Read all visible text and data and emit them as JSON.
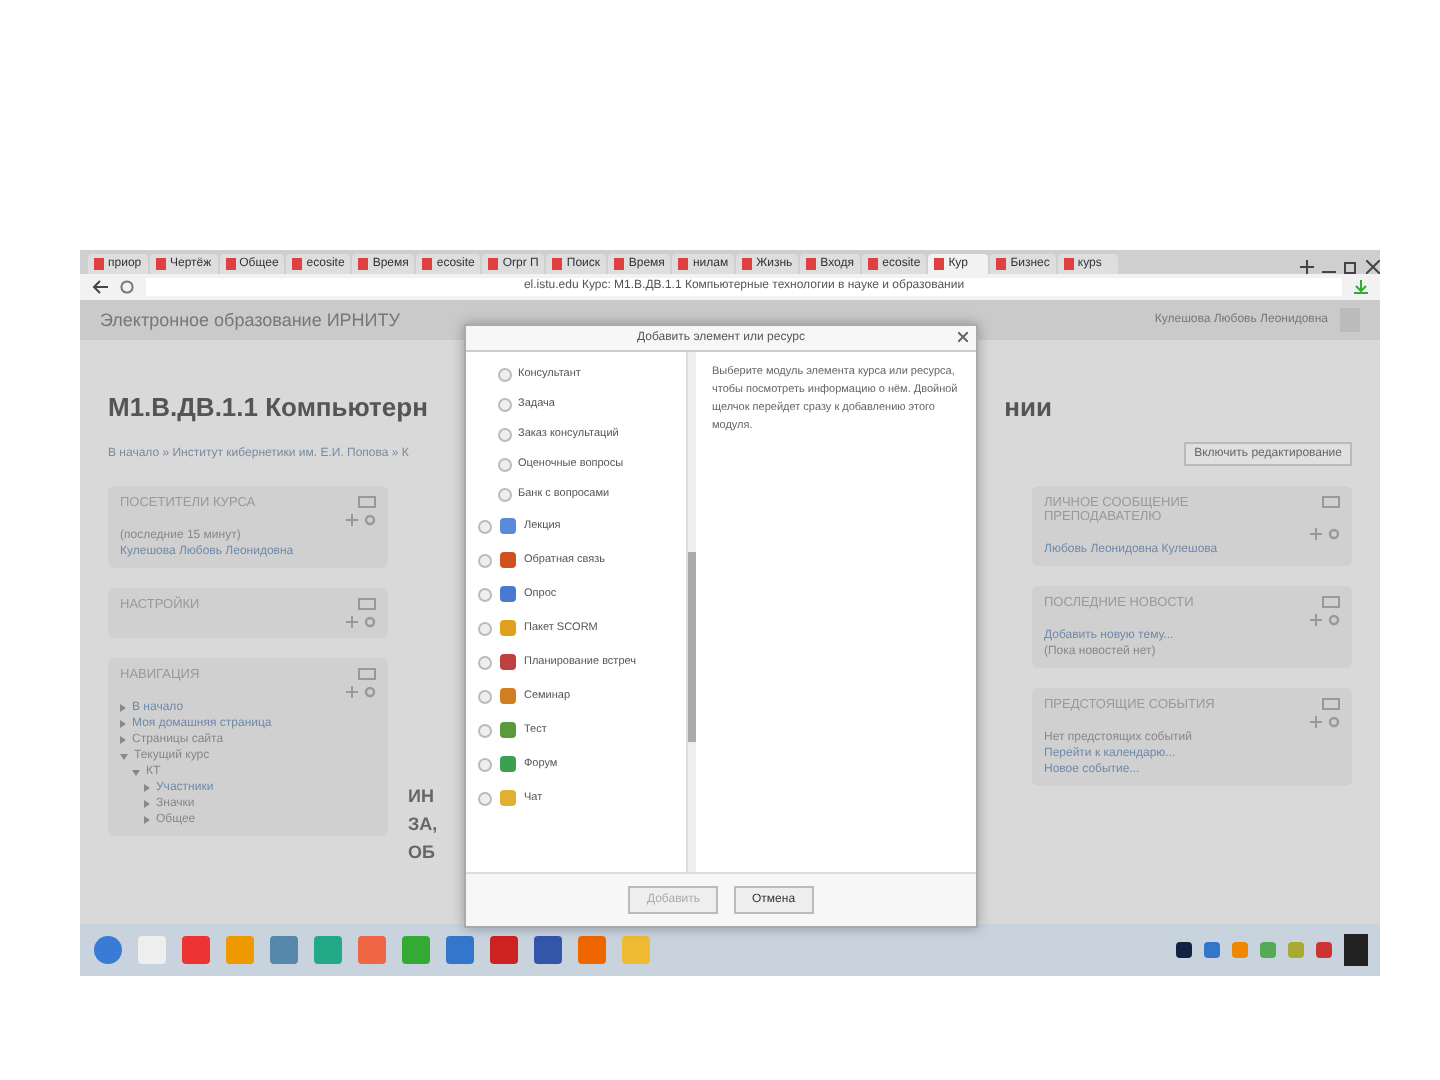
{
  "browser": {
    "tabs": [
      {
        "label": "приор",
        "selected": false
      },
      {
        "label": "Чертёж",
        "selected": false
      },
      {
        "label": "Общее",
        "selected": false
      },
      {
        "label": "ecosite",
        "selected": false
      },
      {
        "label": "Время",
        "selected": false
      },
      {
        "label": "ecosite",
        "selected": false
      },
      {
        "label": "Orpr П",
        "selected": false
      },
      {
        "label": "Поиск",
        "selected": false
      },
      {
        "label": "Время",
        "selected": false
      },
      {
        "label": "нилам",
        "selected": false
      },
      {
        "label": "Жизнь",
        "selected": false
      },
      {
        "label": "Входя",
        "selected": false
      },
      {
        "label": "ecosite",
        "selected": false
      },
      {
        "label": "Кур",
        "selected": true
      },
      {
        "label": "Бизнес",
        "selected": false
      },
      {
        "label": "курs",
        "selected": false
      }
    ],
    "address": "el.istu.edu Курс: М1.В.ДВ.1.1 Компьютерные технологии в науке и образовании"
  },
  "header": {
    "site_name": "Электронное образование ИРНИТУ",
    "user_name": "Кулешова Любовь Леонидовна"
  },
  "course": {
    "title_left": "М1.В.ДВ.1.1 Компьютерн",
    "title_right": "нии",
    "breadcrumb": "В начало » Институт кибернетики им. Е.И. Попова » К",
    "edit_button": "Включить редактирование",
    "section_fragments": [
      "ИН",
      "ЗА,",
      "ОБ"
    ]
  },
  "left_blocks": [
    {
      "title": "ПОСЕТИТЕЛИ КУРСА",
      "lines": [
        {
          "text": "(последние 15 минут)",
          "link": false
        },
        {
          "text": "Кулешова Любовь Леонидовна",
          "link": true
        }
      ]
    },
    {
      "title": "НАСТРОЙКИ"
    },
    {
      "title": "НАВИГАЦИЯ",
      "tree": [
        {
          "label": "В начало",
          "expanded": false,
          "link": true
        },
        {
          "label": "Моя домашняя страница",
          "expanded": false,
          "link": true
        },
        {
          "label": "Страницы сайта",
          "expanded": false,
          "link": false
        },
        {
          "label": "Текущий курс",
          "expanded": true,
          "link": false,
          "children": [
            {
              "label": "КТ",
              "expanded": true,
              "link": false,
              "children": [
                {
                  "label": "Участники",
                  "expanded": false,
                  "link": true
                },
                {
                  "label": "Значки",
                  "expanded": false,
                  "link": false
                },
                {
                  "label": "Общее",
                  "expanded": false,
                  "link": false
                }
              ]
            }
          ]
        }
      ]
    }
  ],
  "right_blocks": [
    {
      "title": "ЛИЧНОЕ СООБЩЕНИЕ ПРЕПОДАВАТЕЛЮ",
      "lines": [
        {
          "text": "Любовь Леонидовна Кулешова",
          "link": true
        }
      ]
    },
    {
      "title": "ПОСЛЕДНИЕ НОВОСТИ",
      "lines": [
        {
          "text": "Добавить новую тему...",
          "link": true
        },
        {
          "text": "(Пока новостей нет)",
          "link": false
        }
      ]
    },
    {
      "title": "ПРЕДСТОЯЩИЕ СОБЫТИЯ",
      "lines": [
        {
          "text": "Нет предстоящих событий",
          "link": false
        },
        {
          "text": "Перейти к календарю...",
          "link": true
        },
        {
          "text": "Новое событие...",
          "link": true
        }
      ]
    }
  ],
  "dialog": {
    "title": "Добавить элемент или ресурс",
    "items": [
      {
        "label": "Консультант",
        "kind": "plain",
        "selected": false
      },
      {
        "label": "Задача",
        "kind": "plain",
        "selected": false
      },
      {
        "label": "Заказ консультаций",
        "kind": "plain",
        "selected": false
      },
      {
        "label": "Оценочные вопросы",
        "kind": "plain",
        "selected": false
      },
      {
        "label": "Банк с вопросами",
        "kind": "plain",
        "selected": false
      },
      {
        "label": "Лекция",
        "kind": "icon",
        "selected": false
      },
      {
        "label": "Обратная связь",
        "kind": "icon",
        "selected": false
      },
      {
        "label": "Опрос",
        "kind": "icon",
        "selected": false
      },
      {
        "label": "Пакет SCORM",
        "kind": "icon",
        "selected": false
      },
      {
        "label": "Планирование встреч",
        "kind": "icon",
        "selected": false
      },
      {
        "label": "Семинар",
        "kind": "icon",
        "selected": false
      },
      {
        "label": "Тест",
        "kind": "icon",
        "selected": false
      },
      {
        "label": "Форум",
        "kind": "icon",
        "selected": false
      },
      {
        "label": "Чат",
        "kind": "icon",
        "selected": false
      }
    ],
    "description": "Выберите модуль элемента курса или ресурса, чтобы посмотреть информацию о нём. Двойной щелчок перейдет сразу к добавлению этого модуля.",
    "buttons": [
      {
        "label": "Добавить",
        "disabled": true
      },
      {
        "label": "Отмена",
        "disabled": false
      }
    ]
  }
}
